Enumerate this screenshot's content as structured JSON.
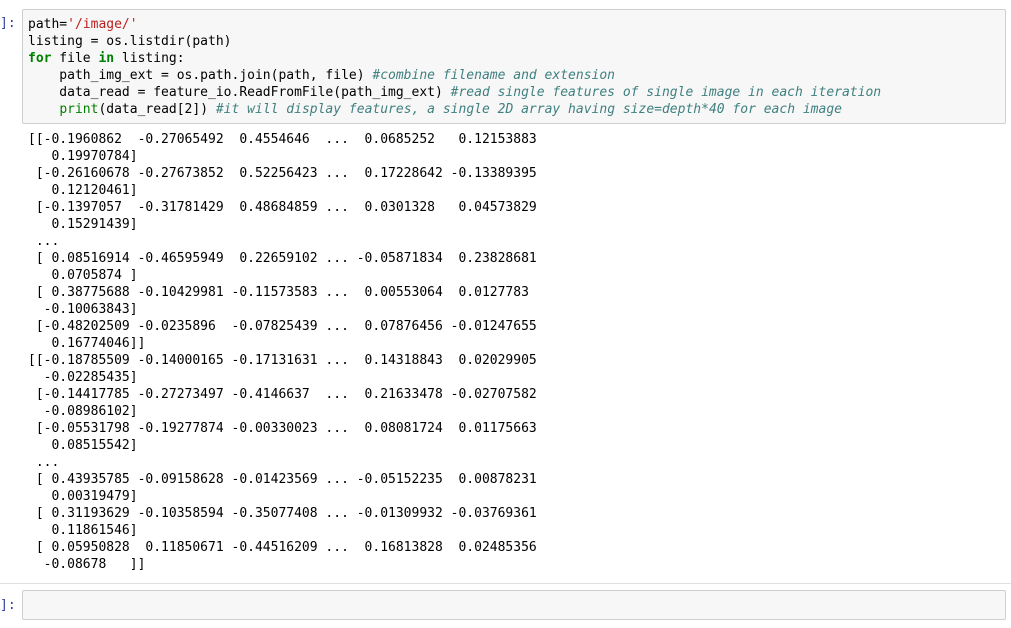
{
  "cell1": {
    "prompt": "]:",
    "code": {
      "line1_a": "path=",
      "line1_str": "'/image/'",
      "line2": "listing = os.listdir(path)",
      "line3_for": "for",
      "line3_a": " file ",
      "line3_in": "in",
      "line3_b": " listing:",
      "line4_a": "    path_img_ext = os.path.join(path, file) ",
      "line4_comment": "#combine filename and extension",
      "line5_a": "    data_read = feature_io.ReadFromFile(path_img_ext) ",
      "line5_comment": "#read single features of single image in each iteration",
      "line6_indent": "    ",
      "line6_print": "print",
      "line6_a": "(data_read[2]) ",
      "line6_comment": "#it will display features, a single 2D array having size=depth*40 for each image"
    },
    "output_lines": [
      "[[-0.1960862  -0.27065492  0.4554646  ...  0.0685252   0.12153883",
      "   0.19970784]",
      " [-0.26160678 -0.27673852  0.52256423 ...  0.17228642 -0.13389395",
      "   0.12120461]",
      " [-0.1397057  -0.31781429  0.48684859 ...  0.0301328   0.04573829",
      "   0.15291439]",
      " ...",
      " [ 0.08516914 -0.46595949  0.22659102 ... -0.05871834  0.23828681",
      "   0.0705874 ]",
      " [ 0.38775688 -0.10429981 -0.11573583 ...  0.00553064  0.0127783",
      "  -0.10063843]",
      " [-0.48202509 -0.0235896  -0.07825439 ...  0.07876456 -0.01247655",
      "   0.16774046]]",
      "[[-0.18785509 -0.14000165 -0.17131631 ...  0.14318843  0.02029905",
      "  -0.02285435]",
      " [-0.14417785 -0.27273497 -0.4146637  ...  0.21633478 -0.02707582",
      "  -0.08986102]",
      " [-0.05531798 -0.19277874 -0.00330023 ...  0.08081724  0.01175663",
      "   0.08515542]",
      " ...",
      " [ 0.43935785 -0.09158628 -0.01423569 ... -0.05152235  0.00878231",
      "   0.00319479]",
      " [ 0.31193629 -0.10358594 -0.35077408 ... -0.01309932 -0.03769361",
      "   0.11861546]",
      " [ 0.05950828  0.11850671 -0.44516209 ...  0.16813828  0.02485356",
      "  -0.08678   ]]"
    ]
  },
  "cell2": {
    "prompt": "]:",
    "code": ""
  },
  "colors": {
    "string": "#ba2121",
    "keyword": "#008000",
    "comment": "#408080",
    "prompt": "#303f9f",
    "cell_bg": "#f7f7f7",
    "cell_border": "#cfcfcf"
  }
}
